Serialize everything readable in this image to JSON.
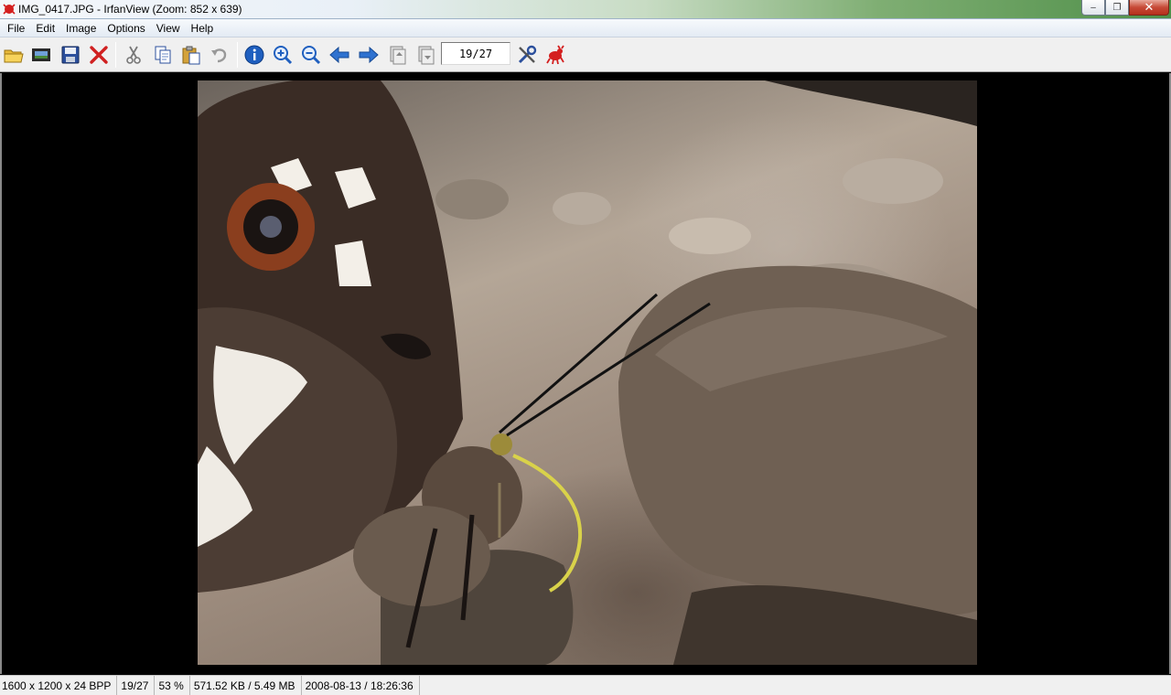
{
  "window": {
    "title": "IMG_0417.JPG - IrfanView (Zoom: 852 x 639)",
    "minimize_label": "–",
    "maximize_label": "❐",
    "close_label": "✕"
  },
  "menu": {
    "items": [
      {
        "label": "File"
      },
      {
        "label": "Edit"
      },
      {
        "label": "Image"
      },
      {
        "label": "Options"
      },
      {
        "label": "View"
      },
      {
        "label": "Help"
      }
    ]
  },
  "toolbar": {
    "page_indicator": "19/27",
    "icons": [
      "open-folder-icon",
      "slideshow-icon",
      "save-icon",
      "delete-icon",
      "cut-icon",
      "copy-icon",
      "paste-icon",
      "undo-icon",
      "info-icon",
      "zoom-in-icon",
      "zoom-out-icon",
      "previous-icon",
      "next-icon",
      "first-page-icon",
      "last-page-icon",
      "settings-icon",
      "irfanview-logo-icon"
    ]
  },
  "status": {
    "dimensions": "1600 x 1200 x 24 BPP",
    "index": "19/27",
    "zoom": "53 %",
    "filesize": "571.52 KB / 5.49 MB",
    "datetime": "2008-08-13 / 18:26:36"
  },
  "colors": {
    "accent_blue": "#1f5fbf",
    "delete_red": "#d02020",
    "canvas_bg": "#000000"
  }
}
